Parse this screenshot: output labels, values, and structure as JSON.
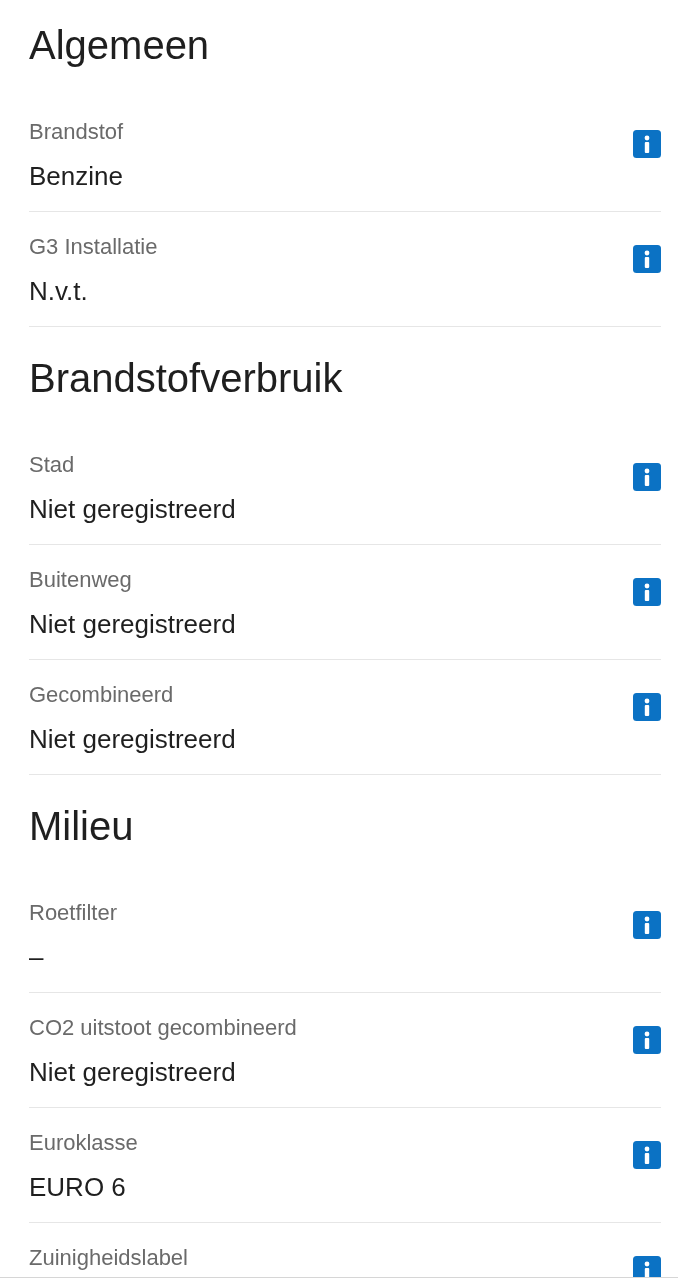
{
  "sections": [
    {
      "title": "Algemeen",
      "rows": [
        {
          "label": "Brandstof",
          "value": "Benzine"
        },
        {
          "label": "G3 Installatie",
          "value": "N.v.t."
        }
      ]
    },
    {
      "title": "Brandstofverbruik",
      "rows": [
        {
          "label": "Stad",
          "value": "Niet geregistreerd"
        },
        {
          "label": "Buitenweg",
          "value": "Niet geregistreerd"
        },
        {
          "label": "Gecombineerd",
          "value": "Niet geregistreerd"
        }
      ]
    },
    {
      "title": "Milieu",
      "rows": [
        {
          "label": "Roetfilter",
          "value": "–"
        },
        {
          "label": "CO2 uitstoot gecombineerd",
          "value": "Niet geregistreerd"
        },
        {
          "label": "Euroklasse",
          "value": "EURO 6"
        },
        {
          "label": "Zuinigheidslabel"
        }
      ]
    }
  ]
}
